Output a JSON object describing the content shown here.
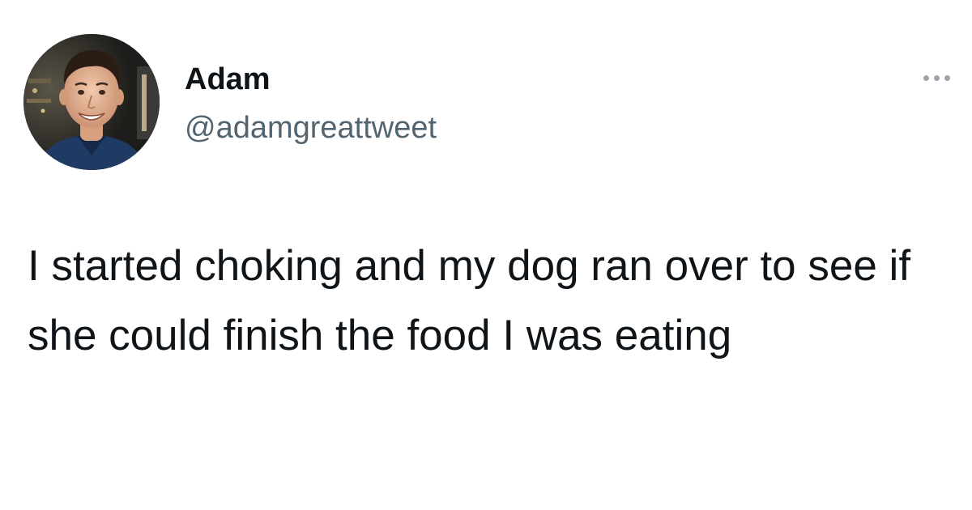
{
  "tweet": {
    "author": {
      "display_name": "Adam",
      "handle": "@adamgreattweet",
      "avatar_icon": "profile-photo"
    },
    "text": "I started choking and my dog ran over to see if she could finish the food I was eating",
    "more_icon": "more-horizontal-icon"
  },
  "colors": {
    "background": "#ffffff",
    "text_primary": "#0f1419",
    "text_secondary": "#536471",
    "icon_muted": "#9aa4ac"
  }
}
